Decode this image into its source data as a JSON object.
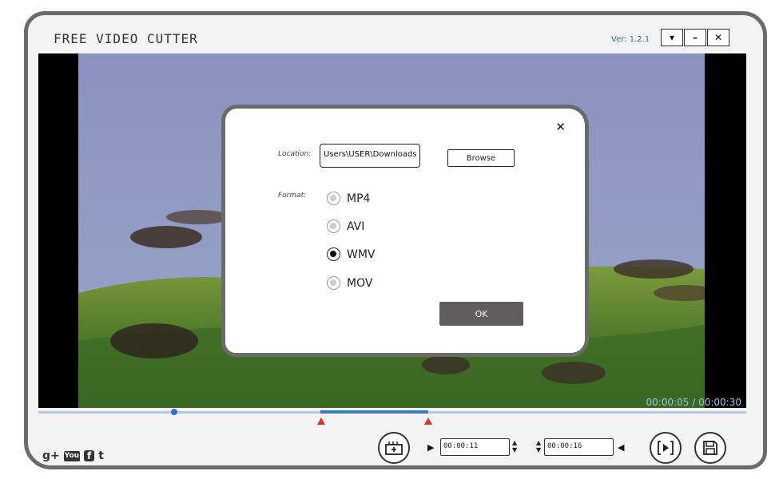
{
  "app": {
    "title": "FREE VIDEO CUTTER",
    "version": "Ver: 1.2.1"
  },
  "window_controls": {
    "menu": "▾",
    "minimize": "–",
    "close": "✕"
  },
  "player": {
    "time_display": "00:00:05 / 00:00:30",
    "start_time": "00:00:11",
    "end_time": "00:00:16"
  },
  "dialog": {
    "close": "✕",
    "location_label": "Location:",
    "location_value": "Users\\USER\\Downloads",
    "browse_label": "Browse",
    "format_label": "Format:",
    "formats": [
      {
        "label": "MP4",
        "selected": false
      },
      {
        "label": "AVI",
        "selected": false
      },
      {
        "label": "WMV",
        "selected": true
      },
      {
        "label": "MOV",
        "selected": false
      }
    ],
    "ok_label": "OK"
  },
  "social": {
    "gplus": "g+",
    "youtube": "You",
    "facebook": "f",
    "twitter": "t"
  },
  "colors": {
    "accent": "#3d7db7",
    "marker": "#d33333",
    "ok_button": "#5f5d5e"
  }
}
